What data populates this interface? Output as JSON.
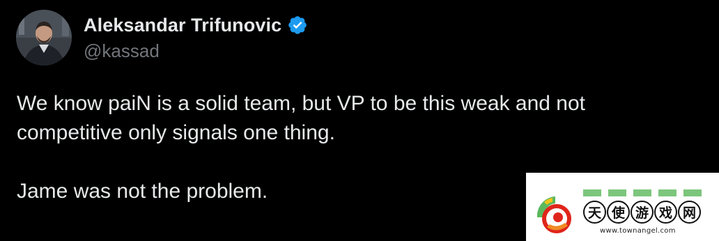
{
  "author": {
    "display_name": "Aleksandar Trifunovic",
    "handle": "@kassad",
    "verified_icon": "verified-badge-icon",
    "verified_color": "#1d9bf0"
  },
  "tweet": {
    "paragraphs": [
      "We know paiN is a solid team, but VP to be this weak and not",
      "competitive only signals one thing.",
      "Jame was not the problem."
    ]
  },
  "watermark": {
    "characters": [
      "天",
      "使",
      "游",
      "戏",
      "网"
    ],
    "url": "www.townangel.com"
  },
  "colors": {
    "background": "#000000",
    "text": "#e7e9ea",
    "secondary_text": "#71767b"
  }
}
